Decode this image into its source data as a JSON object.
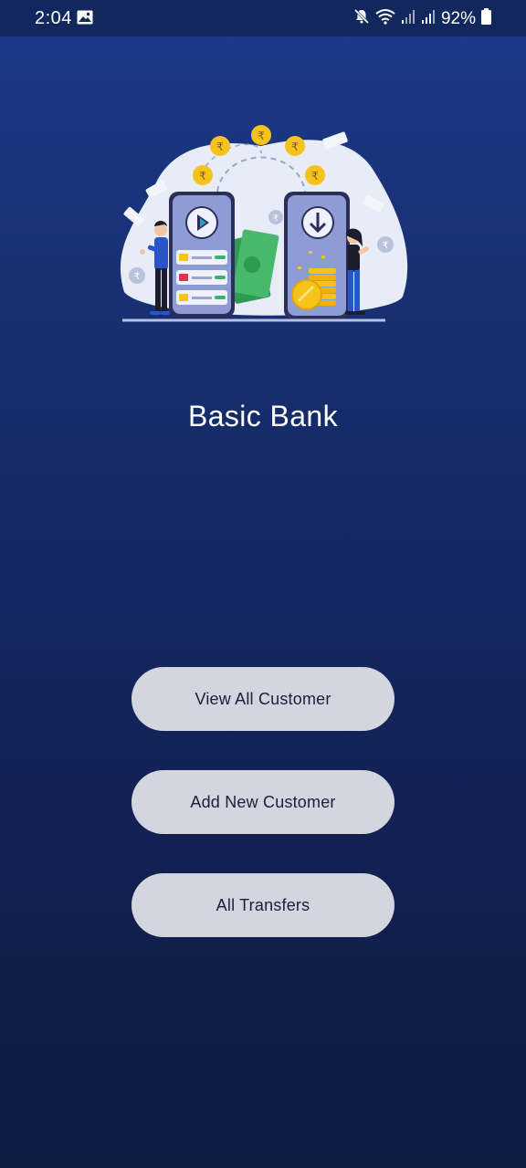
{
  "status_bar": {
    "time": "2:04",
    "battery": "92%",
    "icons": [
      "gallery-icon",
      "mute-icon",
      "wifi-icon",
      "signal-icon",
      "signal-icon",
      "battery-icon"
    ]
  },
  "illustration": {
    "currency_symbol": "₹"
  },
  "app": {
    "title": "Basic Bank"
  },
  "buttons": {
    "view_all": "View All Customer",
    "add_new": "Add New Customer",
    "transfers": "All Transfers"
  },
  "colors": {
    "background_top": "#1c3a8a",
    "background_bottom": "#0e1a40",
    "button_bg": "#d3d6de",
    "button_text": "#1a1f3a",
    "coin": "#f6c21c",
    "phone": "#8e9cd6"
  }
}
